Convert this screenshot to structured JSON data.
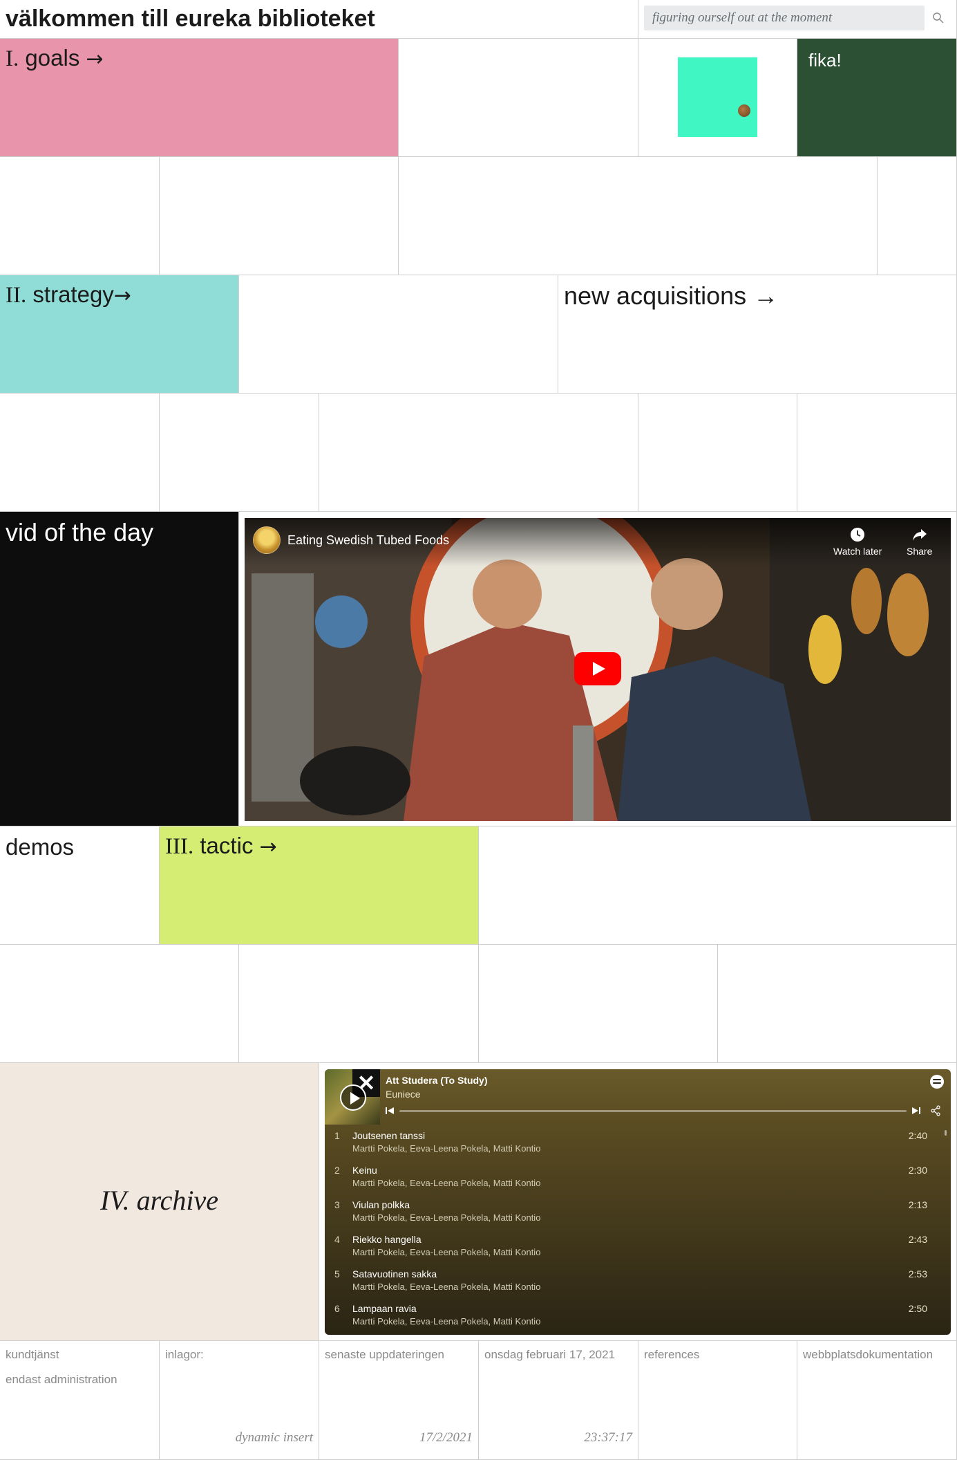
{
  "header": {
    "title": "välkommen till eureka biblioteket",
    "search_placeholder": "figuring ourself out at the moment"
  },
  "sections": {
    "goals": {
      "num": "I.",
      "label": "goals",
      "arrow": "→",
      "color": "#e894aa"
    },
    "strategy": {
      "num": "II.",
      "label": "strategy",
      "arrow": "→",
      "color": "#90dcd6"
    },
    "tactic": {
      "num": "III.",
      "label": "tactic",
      "arrow": "→",
      "color": "#d4ed72"
    },
    "archive": {
      "label": "IV. archive",
      "color": "#f1e8df"
    }
  },
  "tiles": {
    "fika": {
      "label": "fika!",
      "color": "#2b5033"
    },
    "mint_square_color": "#40f7c4",
    "new_acquisitions": "new acquisitions →",
    "vid_of_the_day": "vid of the day",
    "demos": "demos"
  },
  "video": {
    "title": "Eating Swedish Tubed Foods",
    "watch_later": "Watch later",
    "share": "Share",
    "play_color": "#ff0000"
  },
  "spotify": {
    "album": "Att Studera (To Study)",
    "artist": "Euniece",
    "tracks": [
      {
        "n": "1",
        "name": "Joutsenen tanssi",
        "artists": "Martti Pokela, Eeva-Leena Pokela, Matti Kontio",
        "duration": "2:40"
      },
      {
        "n": "2",
        "name": "Keinu",
        "artists": "Martti Pokela, Eeva-Leena Pokela, Matti Kontio",
        "duration": "2:30"
      },
      {
        "n": "3",
        "name": "Viulan polkka",
        "artists": "Martti Pokela, Eeva-Leena Pokela, Matti Kontio",
        "duration": "2:13"
      },
      {
        "n": "4",
        "name": "Riekko hangella",
        "artists": "Martti Pokela, Eeva-Leena Pokela, Matti Kontio",
        "duration": "2:43"
      },
      {
        "n": "5",
        "name": "Satavuotinen sakka",
        "artists": "Martti Pokela, Eeva-Leena Pokela, Matti Kontio",
        "duration": "2:53"
      },
      {
        "n": "6",
        "name": "Lampaan ravia",
        "artists": "Martti Pokela, Eeva-Leena Pokela, Matti Kontio",
        "duration": "2:50"
      }
    ]
  },
  "footer": {
    "kundtjanst": "kundtjänst",
    "admin": "endast administration",
    "inlagor": "inlagor:",
    "inlagor_value": "dynamic insert",
    "senaste": "senaste uppdateringen",
    "senaste_value": "17/2/2021",
    "date": "onsdag februari 17, 2021",
    "time": "23:37:17",
    "references": "references",
    "docs": "webbplatsdokumentation"
  }
}
